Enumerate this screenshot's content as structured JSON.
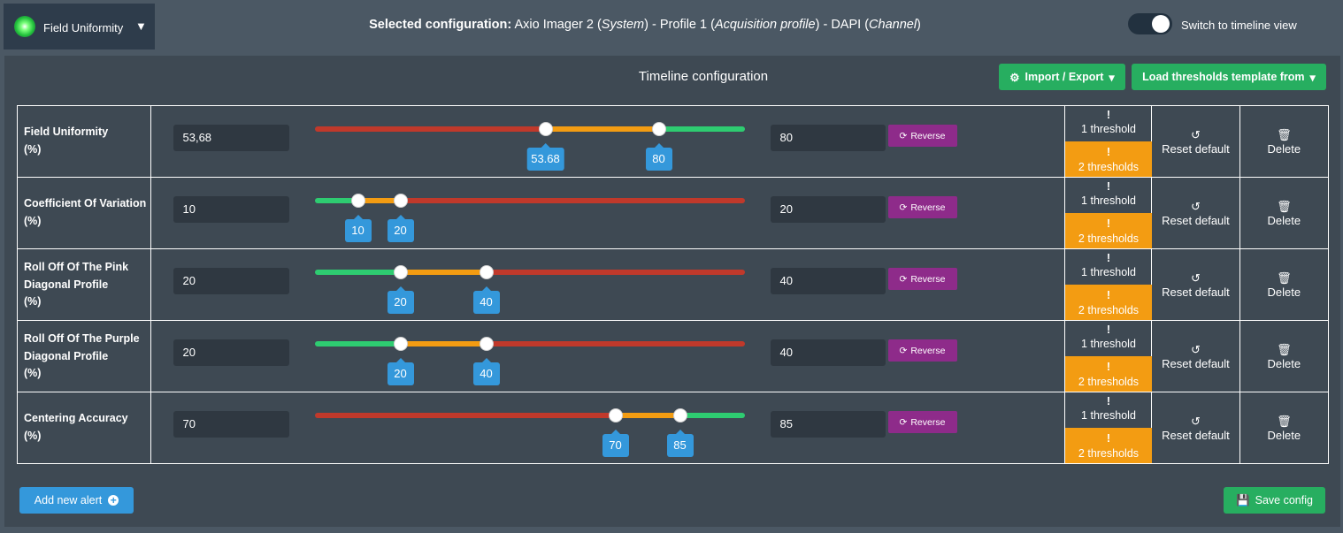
{
  "header": {
    "metric_name": "Field Uniformity",
    "caret_icon": "▼",
    "selected_configuration": {
      "label": "Selected configuration:",
      "system": "Axio Imager 2",
      "system_type": "System",
      "profile": "Profile 1",
      "profile_type": "Acquisition profile",
      "channel": "DAPI",
      "channel_type": "Channel",
      "sep": " - "
    },
    "toggle_label": "Switch to timeline view"
  },
  "panel": {
    "title": "Timeline configuration",
    "import_export_label": "Import / Export",
    "load_template_label": "Load thresholds template from",
    "gear_icon": "⚙",
    "caret_small_icon": "▾"
  },
  "colors": {
    "red": "#c0392b",
    "orange": "#f39c12",
    "green": "#2ecc71",
    "accent_blue": "#3498db",
    "reverse_purple": "#8e2b8a"
  },
  "alerts": [
    {
      "label_lines": [
        "Field Uniformity",
        "(%)"
      ],
      "low_value": "53,68",
      "high_value": "80",
      "low_bubble": "53.68",
      "high_bubble": "80",
      "low_fraction": 0.537,
      "high_fraction": 0.8,
      "order": [
        "red",
        "orange",
        "green"
      ]
    },
    {
      "label_lines": [
        "Coefficient Of Variation",
        "(%)"
      ],
      "low_value": "10",
      "high_value": "20",
      "low_bubble": "10",
      "high_bubble": "20",
      "low_fraction": 0.1,
      "high_fraction": 0.2,
      "order": [
        "green",
        "orange",
        "red"
      ]
    },
    {
      "label_lines": [
        "Roll Off Of The Pink",
        "Diagonal Profile",
        "(%)"
      ],
      "low_value": "20",
      "high_value": "40",
      "low_bubble": "20",
      "high_bubble": "40",
      "low_fraction": 0.2,
      "high_fraction": 0.4,
      "order": [
        "green",
        "orange",
        "red"
      ]
    },
    {
      "label_lines": [
        "Roll Off Of The Purple",
        "Diagonal Profile",
        "(%)"
      ],
      "low_value": "20",
      "high_value": "40",
      "low_bubble": "20",
      "high_bubble": "40",
      "low_fraction": 0.2,
      "high_fraction": 0.4,
      "order": [
        "green",
        "orange",
        "red"
      ]
    },
    {
      "label_lines": [
        "Centering Accuracy",
        "(%)"
      ],
      "low_value": "70",
      "high_value": "85",
      "low_bubble": "70",
      "high_bubble": "85",
      "low_fraction": 0.7,
      "high_fraction": 0.85,
      "order": [
        "red",
        "orange",
        "green"
      ]
    }
  ],
  "row_actions": {
    "reverse_label": "Reverse",
    "reverse_icon": "⟳",
    "one_threshold_icon": "!",
    "one_threshold_label": "1 threshold",
    "two_thresholds_icon": "!",
    "two_thresholds_label": "2 thresholds",
    "reset_icon": "↺",
    "reset_label": "Reset default",
    "delete_icon": "🗑",
    "delete_label": "Delete"
  },
  "footer": {
    "add_alert_label": "Add new alert",
    "plus_icon": "+",
    "save_label": "Save config",
    "save_icon": "💾"
  }
}
